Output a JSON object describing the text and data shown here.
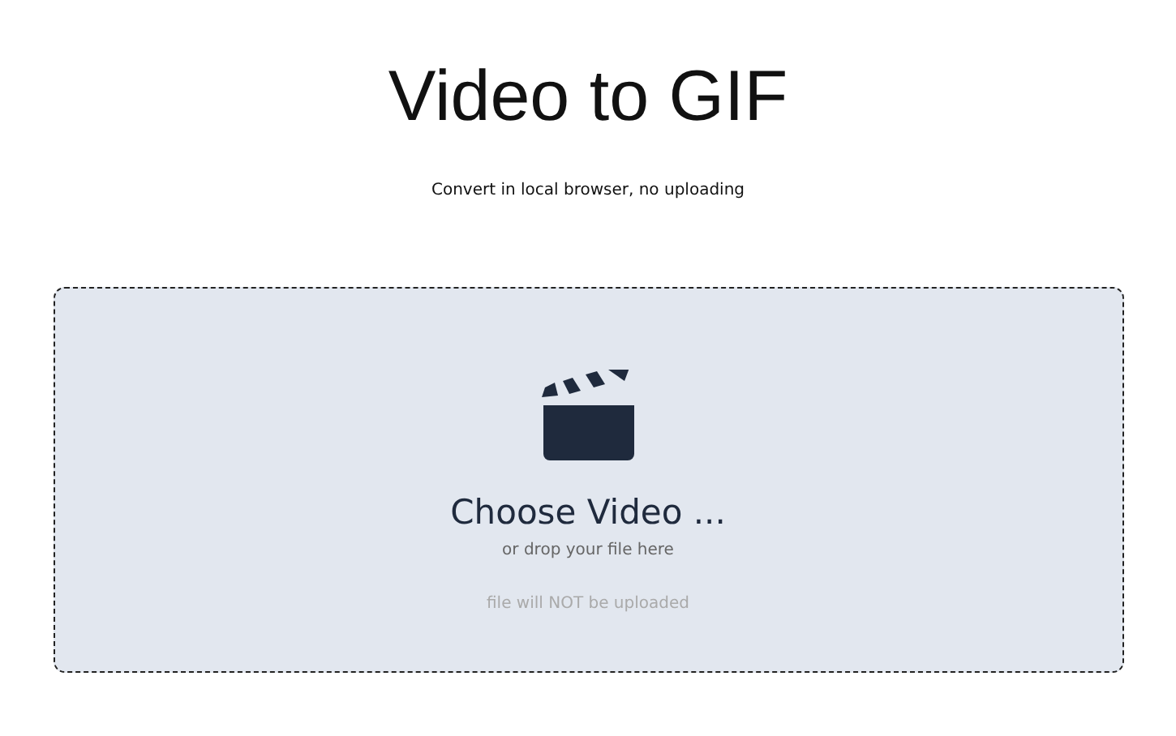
{
  "title": "Video to GIF",
  "subtitle": "Convert in local browser, no uploading",
  "dropzone": {
    "label": "Choose Video ...",
    "hint": "or drop your file here",
    "note": "file will NOT be uploaded"
  }
}
